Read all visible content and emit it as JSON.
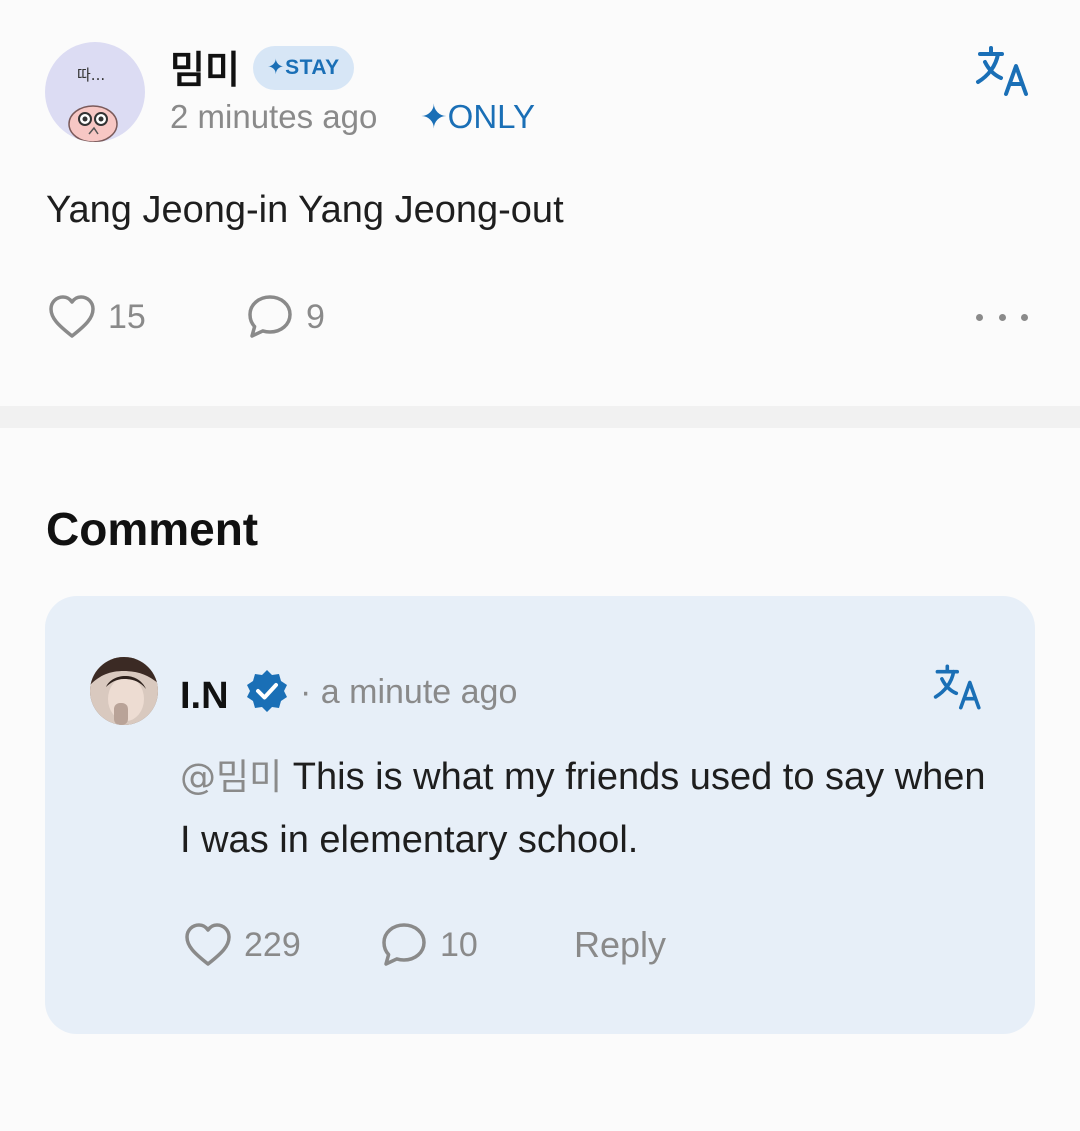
{
  "post": {
    "author": "밈미",
    "avatar_text": "따...",
    "badge": "✦STAY",
    "time": "2 minutes ago",
    "only_tag": "✦ONLY",
    "body": "Yang Jeong-in Yang Jeong-out",
    "likes": "15",
    "comments": "9"
  },
  "comment_section": {
    "heading": "Comment",
    "comment": {
      "author": "I.N",
      "time": "· a minute ago",
      "mention": "@밈미",
      "body": " This is what my friends used to say when I was in elementary school.",
      "likes": "229",
      "replies": "10",
      "reply_label": "Reply"
    }
  },
  "colors": {
    "accent": "#1a6fb6",
    "badge_bg": "#d7e6f6",
    "card_bg": "#e7eff8",
    "muted": "#8a8a8a"
  },
  "icons": [
    "translate-icon",
    "heart-icon",
    "comment-bubble-icon",
    "more-icon",
    "verified-badge-icon"
  ]
}
